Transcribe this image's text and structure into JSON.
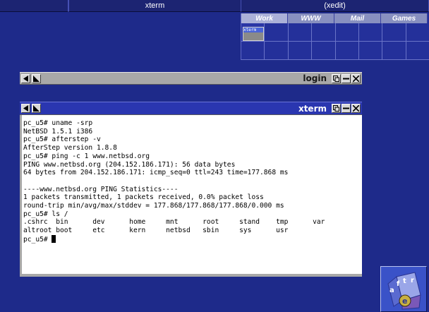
{
  "winlist": {
    "slots": [
      {
        "label": "",
        "width": 97
      },
      {
        "label": "",
        "width": 1
      },
      {
        "label": "xterm",
        "width": 244
      },
      {
        "label": "(xedit)",
        "width": 266
      }
    ]
  },
  "pager": {
    "desks": [
      "Work",
      "WWW",
      "Mail",
      "Games"
    ],
    "mini_window_label": "xterm"
  },
  "login_window": {
    "title": "login"
  },
  "xterm_window": {
    "title": "xterm",
    "lines": [
      "pc_u5# uname -srp",
      "NetBSD 1.5.1 i386",
      "pc_u5# afterstep -v",
      "AfterStep version 1.8.8",
      "pc_u5# ping -c 1 www.netbsd.org",
      "PING www.netbsd.org (204.152.186.171): 56 data bytes",
      "64 bytes from 204.152.186.171: icmp_seq=0 ttl=243 time=177.868 ms",
      "",
      "----www.netbsd.org PING Statistics----",
      "1 packets transmitted, 1 packets received, 0.0% packet loss",
      "round-trip min/avg/max/stddev = 177.868/177.868/177.868/0.000 ms",
      "pc_u5# ls /",
      ".cshrc  bin      dev      home     mnt      root     stand    tmp      var",
      "altroot boot     etc      kern     netbsd   sbin     sys      usr"
    ],
    "prompt": "pc_u5# "
  },
  "wharf": {
    "logo_letters": [
      "a",
      "f",
      "t",
      "e",
      "r"
    ]
  },
  "colors": {
    "desktop": "#1e2a8a",
    "focused_title": "#2a36b0",
    "unfocused_title": "#a8a8a8"
  }
}
